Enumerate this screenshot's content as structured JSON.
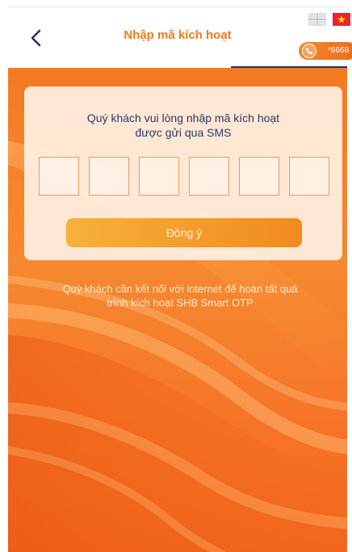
{
  "header": {
    "title": "Nhập mã kích hoạt",
    "back_icon": "chevron-left-icon",
    "hotline": "*6668"
  },
  "languages": [
    "en",
    "vi"
  ],
  "card": {
    "instruction_line1": "Quý khách vui lòng nhập mã kích hoạt",
    "instruction_line2": "được gửi qua SMS",
    "otp_digits": [
      "",
      "",
      "",
      "",
      "",
      ""
    ],
    "confirm_label": "Đồng ý"
  },
  "note": {
    "line1": "Quý khách cần kết nối với internet để hoàn tất quá",
    "line2": "trình kích hoạt SHB Smart OTP"
  },
  "colors": {
    "accent": "#ef7b1a",
    "navy": "#23346d",
    "background_orange": "#f5892f"
  }
}
